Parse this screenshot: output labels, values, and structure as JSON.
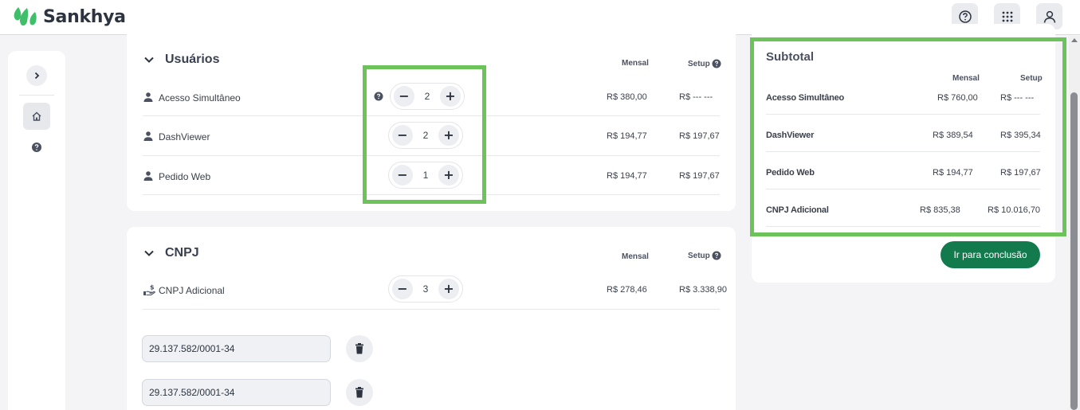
{
  "app": {
    "logo_text": "Sankhya",
    "colors": {
      "brand_green": "#3fbf6a",
      "cta_green": "#137a4e",
      "highlight": "#6cc35a"
    },
    "header_icons": [
      "help-icon",
      "apps-grid-icon",
      "user-icon"
    ]
  },
  "sidebar": {
    "items": [
      {
        "icon": "chevron-right-icon"
      },
      {
        "icon": "home-icon"
      },
      {
        "icon": "help-icon"
      }
    ]
  },
  "usuarios": {
    "title": "Usuários",
    "col_mensal": "Mensal",
    "col_setup": "Setup",
    "rows": [
      {
        "label": "Acesso Simultâneo",
        "quantity": "2",
        "mensal": "R$ 380,00",
        "setup": "R$ --- ---"
      },
      {
        "label": "DashViewer",
        "quantity": "2",
        "mensal": "R$ 194,77",
        "setup": "R$ 197,67"
      },
      {
        "label": "Pedido Web",
        "quantity": "1",
        "mensal": "R$ 194,77",
        "setup": "R$ 197,67"
      }
    ]
  },
  "cnpj": {
    "title": "CNPJ",
    "col_mensal": "Mensal",
    "col_setup": "Setup",
    "row": {
      "label": "CNPJ Adicional",
      "quantity": "3",
      "mensal": "R$ 278,46",
      "setup": "R$ 3.338,90"
    },
    "entries": [
      {
        "value": "29.137.582/0001-34"
      },
      {
        "value": "29.137.582/0001-34"
      }
    ]
  },
  "subtotal": {
    "title": "Subtotal",
    "col_mensal": "Mensal",
    "col_setup": "Setup",
    "rows": [
      {
        "label": "Acesso Simultâneo",
        "mensal": "R$ 760,00",
        "setup": "R$ --- ---"
      },
      {
        "label": "DashViewer",
        "mensal": "R$ 389,54",
        "setup": "R$ 395,34"
      },
      {
        "label": "Pedido Web",
        "mensal": "R$ 194,77",
        "setup": "R$ 197,67"
      },
      {
        "label": "CNPJ Adicional",
        "mensal": "R$ 835,38",
        "setup": "R$ 10.016,70"
      }
    ],
    "cta_label": "Ir para conclusão"
  }
}
